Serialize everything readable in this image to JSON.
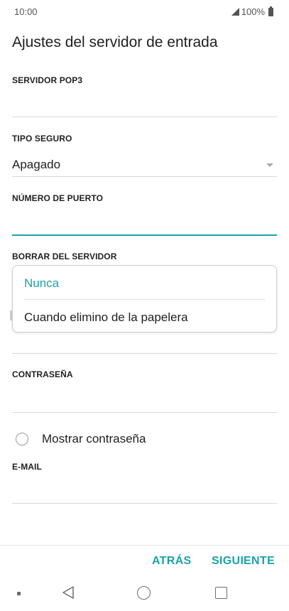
{
  "status_bar": {
    "time": "10:00",
    "battery": "100%"
  },
  "page": {
    "title": "Ajustes del servidor de entrada"
  },
  "fields": {
    "pop3_server": {
      "label": "SERVIDOR POP3",
      "value": ""
    },
    "security_type": {
      "label": "TIPO SEGURO",
      "value": "Apagado"
    },
    "port_number": {
      "label": "NÚMERO DE PUERTO",
      "value": ""
    },
    "delete_from_server": {
      "label": "BORRAR DEL SERVIDOR"
    },
    "password": {
      "label": "CONTRASEÑA",
      "value": ""
    },
    "email": {
      "label": "E-MAIL",
      "value": ""
    }
  },
  "popup_menu": {
    "options": [
      "Nunca",
      "Cuando elimino de la papelera"
    ],
    "selected": "Nunca"
  },
  "show_password": {
    "label": "Mostrar contraseña",
    "checked": false
  },
  "actions": {
    "back_label": "ATRÁS",
    "next_label": "SIGUIENTE"
  },
  "colors": {
    "accent": "#1aa3a8",
    "text": "#1f1f1f",
    "divider": "#d7d7d7"
  }
}
